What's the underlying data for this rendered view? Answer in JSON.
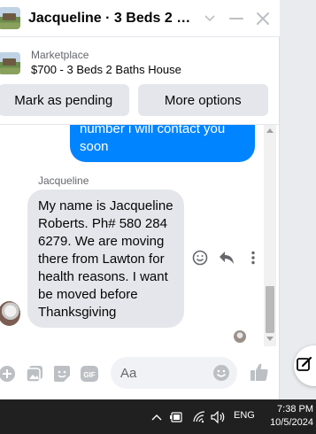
{
  "header": {
    "title": "Jacqueline · 3 Beds 2 Bath…"
  },
  "listing": {
    "label": "Marketplace",
    "title": "$700 - 3 Beds 2 Baths House"
  },
  "actions": {
    "pending_label": "Mark as pending",
    "more_label": "More options"
  },
  "messages": {
    "outgoing_text": "number i will contact you soon",
    "sender": "Jacqueline",
    "incoming_text": "My name is Jacqueline Roberts. Ph# 580  284 6279. We are moving there from Lawton for health reasons. I want be moved before Thanksgiving"
  },
  "composer": {
    "placeholder": "Aa"
  },
  "taskbar": {
    "language": "ENG",
    "time": "7:38 PM",
    "date": "10/5/2024"
  },
  "colors": {
    "accent": "#0084ff",
    "bubble_in": "#e4e6eb",
    "taskbar": "#202020"
  },
  "icons": {
    "header": [
      "chevron-down-icon",
      "minimize-icon",
      "close-icon"
    ],
    "message": [
      "emoji-react-icon",
      "reply-icon",
      "more-vertical-icon"
    ],
    "composer": [
      "plus-icon",
      "photo-icon",
      "sticker-icon",
      "gif-icon",
      "emoji-icon",
      "thumbs-up-icon"
    ],
    "taskbar": [
      "chevron-up-icon",
      "battery-icon",
      "wifi-icon",
      "volume-icon"
    ],
    "fab": "new-message-icon"
  }
}
